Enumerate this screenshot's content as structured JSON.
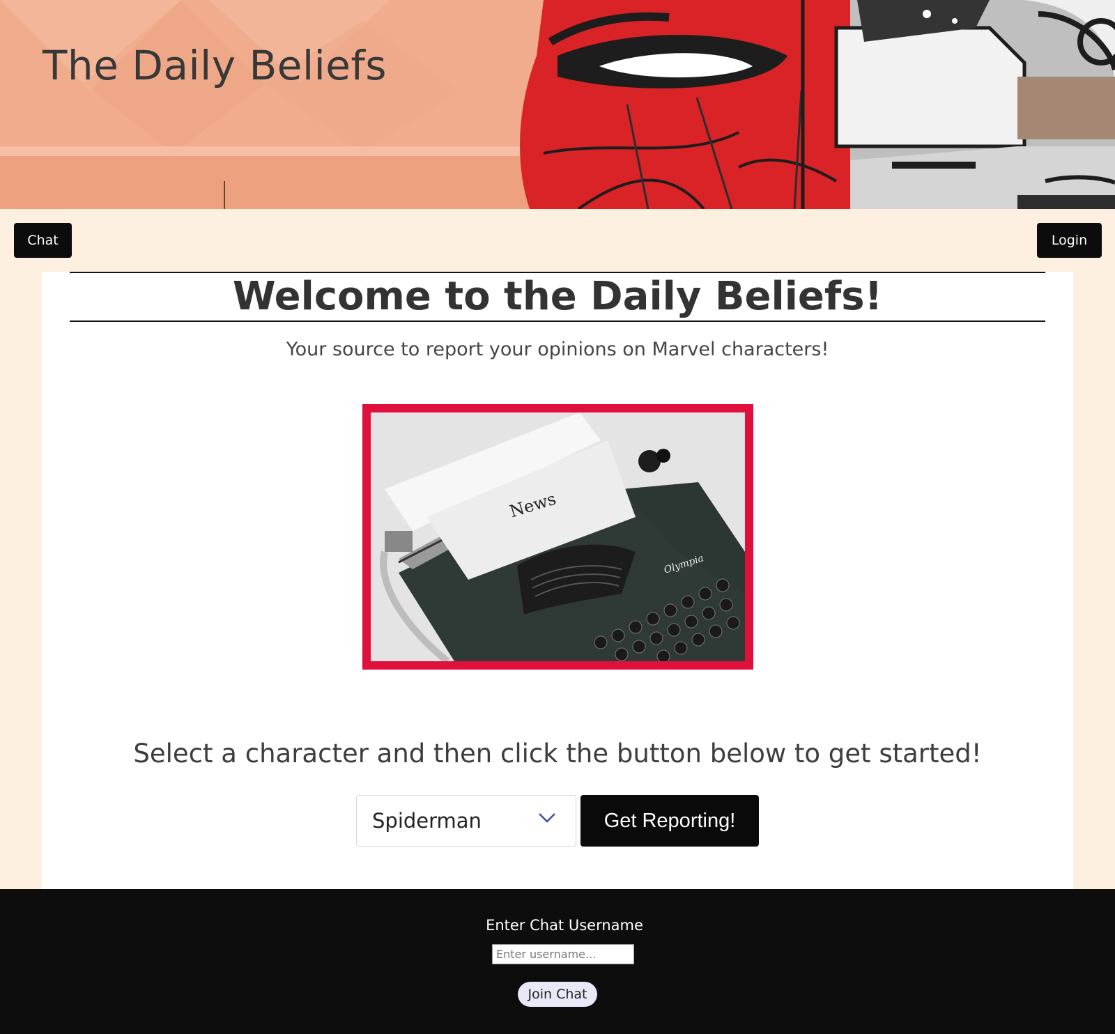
{
  "hero": {
    "title": "The Daily Beliefs"
  },
  "nav": {
    "chat_label": "Chat",
    "login_label": "Login"
  },
  "main": {
    "heading": "Welcome to the Daily Beliefs!",
    "tagline": "Your source to report your opinions on Marvel characters!",
    "image": {
      "paper_text": "News",
      "brand_text": "Olympia",
      "frame_color": "#e0103c"
    },
    "prompt": "Select a character and then click the button below to get started!",
    "character_select": {
      "selected": "Spiderman"
    },
    "report_button": "Get Reporting!"
  },
  "footer": {
    "label": "Enter Chat Username",
    "username_placeholder": "Enter username...",
    "join_button": "Join Chat"
  },
  "colors": {
    "page_bg": "#fdf0e1",
    "dark": "#0c0c0c",
    "accent": "#e0103c"
  }
}
